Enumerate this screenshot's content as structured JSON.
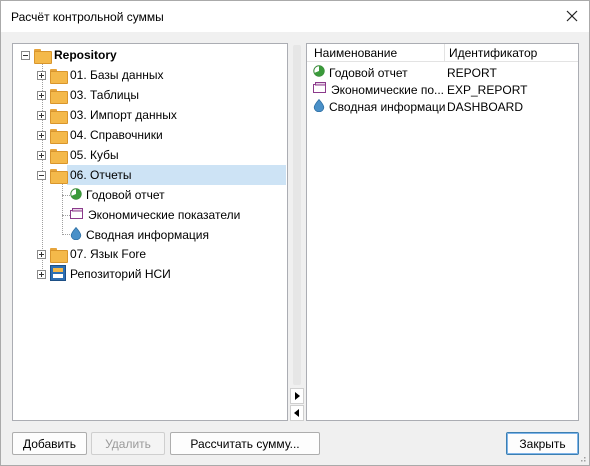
{
  "window": {
    "title": "Расчёт контрольной суммы"
  },
  "tree": {
    "root": {
      "label": "Repository",
      "expanded": true
    },
    "items": [
      {
        "label": "01. Базы данных",
        "icon": "folder-icon",
        "expander": "plus"
      },
      {
        "label": "03. Таблицы",
        "icon": "folder-icon",
        "expander": "plus"
      },
      {
        "label": "03. Импорт данных",
        "icon": "folder-icon",
        "expander": "plus"
      },
      {
        "label": "04. Справочники",
        "icon": "folder-icon",
        "expander": "plus"
      },
      {
        "label": "05. Кубы",
        "icon": "folder-icon",
        "expander": "plus"
      },
      {
        "label": "06. Отчеты",
        "icon": "folder-icon",
        "expander": "minus",
        "selected": true
      },
      {
        "label": "Годовой отчет",
        "icon": "report-icon",
        "child": true
      },
      {
        "label": "Экономические показатели",
        "icon": "express-report-icon",
        "child": true
      },
      {
        "label": "Сводная информация",
        "icon": "dashboard-icon",
        "child": true
      },
      {
        "label": "07. Язык Fore",
        "icon": "folder-icon",
        "expander": "plus"
      },
      {
        "label": "Репозиторий НСИ",
        "icon": "nsi-repository-icon",
        "expander": "plus"
      }
    ]
  },
  "grid": {
    "columns": [
      "Наименование",
      "Идентификатор"
    ],
    "rows": [
      {
        "name": "Годовой отчет",
        "id": "REPORT",
        "icon": "report-icon"
      },
      {
        "name": "Экономические по...",
        "id": "EXP_REPORT",
        "icon": "express-report-icon"
      },
      {
        "name": "Сводная информация",
        "id": "DASHBOARD",
        "icon": "dashboard-icon"
      }
    ]
  },
  "buttons": {
    "add": "Добавить",
    "delete": "Удалить",
    "calculate": "Рассчитать сумму...",
    "close": "Закрыть"
  },
  "colors": {
    "selection": "#cde3f5",
    "folder": "#f4b94a",
    "accent_border": "#3c7fb1"
  }
}
